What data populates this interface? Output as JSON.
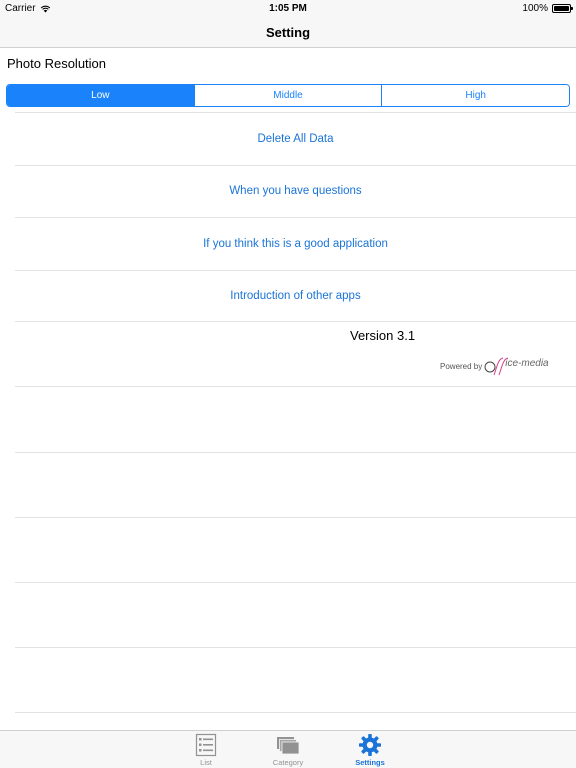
{
  "status_bar": {
    "carrier": "Carrier",
    "time": "1:05 PM",
    "battery": "100%"
  },
  "nav": {
    "title": "Setting"
  },
  "photo_resolution": {
    "label": "Photo Resolution",
    "options": [
      "Low",
      "Middle",
      "High"
    ],
    "selected": "Low"
  },
  "menu": {
    "items": [
      "Delete All Data",
      "When you have questions",
      "If you think this is a good application",
      "Introduction of other apps"
    ]
  },
  "version": {
    "text": "Version 3.1",
    "powered_by": "Powered by",
    "logo_text": "ice-media"
  },
  "tabs": [
    {
      "label": "List",
      "icon": "list-icon",
      "active": false
    },
    {
      "label": "Category",
      "icon": "folders-icon",
      "active": false
    },
    {
      "label": "Settings",
      "icon": "gear-icon",
      "active": true
    }
  ],
  "colors": {
    "accent": "#1a82fb",
    "link": "#1a74d8",
    "bar_bg": "#f7f7f7",
    "separator": "#e2e2e4"
  }
}
